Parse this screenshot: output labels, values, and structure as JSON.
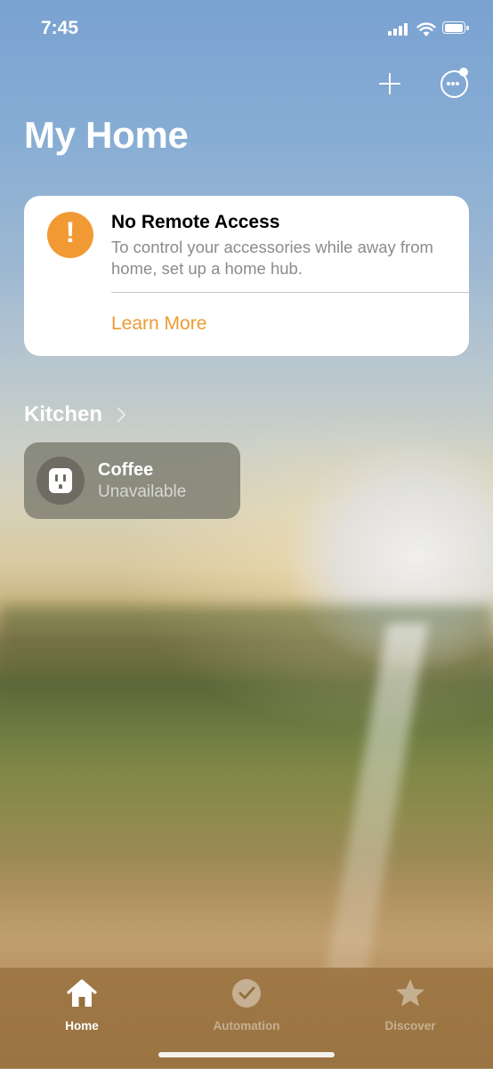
{
  "status_bar": {
    "time": "7:45"
  },
  "header": {
    "title": "My Home"
  },
  "alert": {
    "title": "No Remote Access",
    "body": "To control your accessories while away from home, set up a home hub.",
    "link": "Learn More",
    "icon": "exclamation-icon",
    "icon_glyph": "!",
    "accent": "#f19a34"
  },
  "room": {
    "name": "Kitchen",
    "accessories": [
      {
        "name": "Coffee",
        "status": "Unavailable",
        "icon": "outlet-icon"
      }
    ]
  },
  "tabs": [
    {
      "label": "Home",
      "icon": "house-icon",
      "selected": true
    },
    {
      "label": "Automation",
      "icon": "clock-icon",
      "selected": false
    },
    {
      "label": "Discover",
      "icon": "star-icon",
      "selected": false
    }
  ]
}
